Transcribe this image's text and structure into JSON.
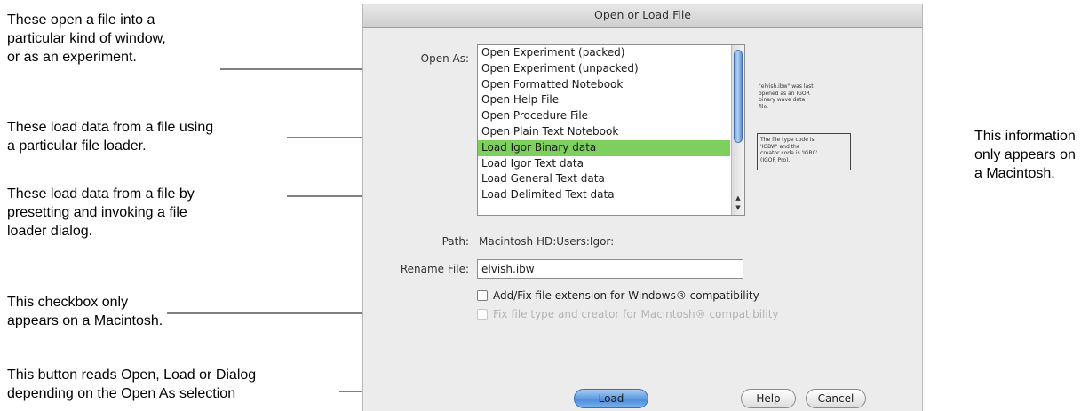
{
  "annotations": {
    "open_file": [
      "These open a file into a",
      "particular kind of window,",
      "or as an experiment."
    ],
    "load_data": [
      "These load data from a file using",
      "a particular file loader."
    ],
    "load_dialog": [
      "These load data from a file by",
      "presetting and invoking a file",
      "loader dialog."
    ],
    "checkbox_note": [
      "This checkbox only",
      "appears on a Macintosh."
    ],
    "button_note": [
      "This button reads Open, Load or Dialog",
      "depending on the Open As selection"
    ],
    "info_note": [
      "This information",
      "only appears on",
      "a Macintosh."
    ]
  },
  "dialog": {
    "title": "Open or Load File",
    "open_as_label": "Open As:",
    "open_as_items": [
      "Open Experiment (packed)",
      "Open Experiment (unpacked)",
      "Open Formatted Notebook",
      "Open Help File",
      "Open Procedure File",
      "Open Plain Text Notebook",
      "Load Igor Binary data",
      "Load Igor Text data",
      "Load General Text data",
      "Load Delimited Text data"
    ],
    "selected_item": "Load Igor Binary data",
    "info_text": [
      "\"elvish.ibw\" was last",
      "opened as an IGOR",
      "binary wave data",
      "file."
    ],
    "info_box_text": [
      "The file type code is",
      "'IGBW' and the",
      "creator code is 'IGR0'",
      "(IGOR Pro)."
    ],
    "path_label": "Path:",
    "path_value": "Macintosh HD:Users:Igor:",
    "rename_label": "Rename File:",
    "rename_value": "elvish.ibw",
    "checkbox_extension": "Add/Fix file extension for Windows® compatibility",
    "checkbox_type_creator": "Fix file type and creator for Macintosh® compatibility",
    "buttons": {
      "load": "Load",
      "help": "Help",
      "cancel": "Cancel"
    }
  }
}
